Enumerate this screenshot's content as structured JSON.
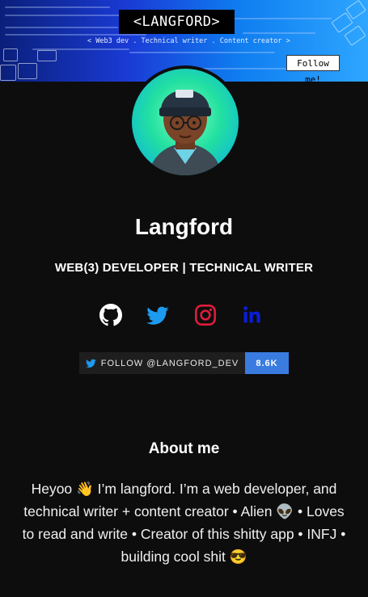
{
  "banner": {
    "title": "<LANGFORD>",
    "subtitle": "<  Web3 dev . Technical writer . Content creator  >",
    "follow_tag": "Follow me!"
  },
  "profile": {
    "name": "Langford",
    "role": "WEB(3) DEVELOPER | TECHNICAL WRITER"
  },
  "social": [
    {
      "icon": "github-icon",
      "color": "#ffffff"
    },
    {
      "icon": "twitter-icon",
      "color": "#1d9bf0"
    },
    {
      "icon": "instagram-icon",
      "color": "#e1306c"
    },
    {
      "icon": "linkedin-icon",
      "color": "#0a1ed6"
    }
  ],
  "follow_button": {
    "label": "FOLLOW @LANGFORD_DEV",
    "count": "8.6K",
    "accent": "#3a7be0"
  },
  "about": {
    "title": "About me",
    "text": "Heyoo 👋 I’m langford. I’m a web developer, and technical writer + content creator • Alien 👽 • Loves to read and write • Creator of this shitty app • INFJ • building cool shit 😎"
  }
}
